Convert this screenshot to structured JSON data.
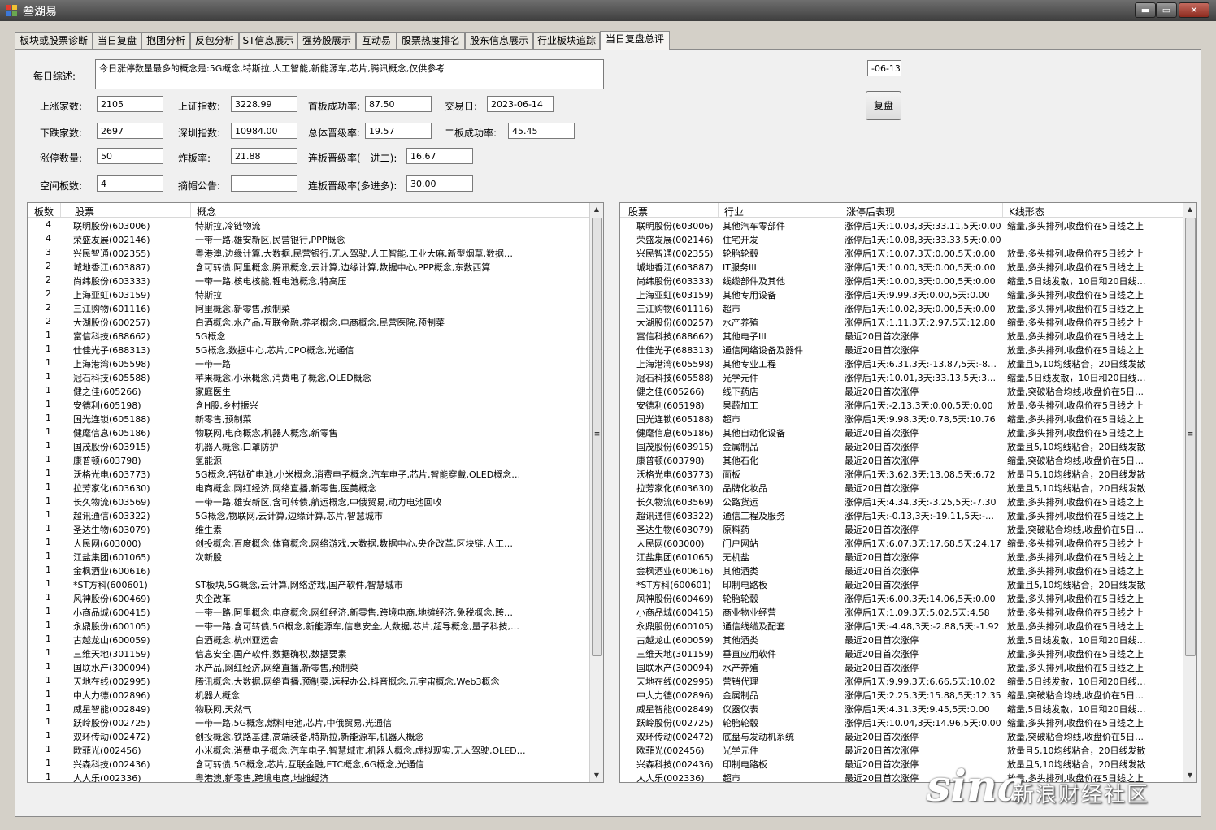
{
  "app": {
    "title": "叁湖易"
  },
  "window_buttons": {
    "minimize": "▬",
    "maximize": "▭",
    "close": "✕"
  },
  "tabs": [
    {
      "label": "板块或股票诊断"
    },
    {
      "label": "当日复盘"
    },
    {
      "label": "抱团分析"
    },
    {
      "label": "反包分析"
    },
    {
      "label": "ST信息展示"
    },
    {
      "label": "强势股展示"
    },
    {
      "label": "互动易"
    },
    {
      "label": "股票热度排名"
    },
    {
      "label": "股东信息展示"
    },
    {
      "label": "行业板块追踪"
    },
    {
      "label": "当日复盘总评"
    }
  ],
  "active_tab_index": 10,
  "summary": {
    "label": "每日综述:",
    "value": "今日涨停数量最多的概念是:5G概念,特斯拉,人工智能,新能源车,芯片,腾讯概念,仅供参考"
  },
  "stats": {
    "up_count": {
      "label": "上涨家数:",
      "value": "2105"
    },
    "sh_index": {
      "label": "上证指数:",
      "value": "3228.99"
    },
    "first_board_rate": {
      "label": "首板成功率:",
      "value": "87.50"
    },
    "trade_day": {
      "label": "交易日:",
      "value": "2023-06-14"
    },
    "down_count": {
      "label": "下跌家数:",
      "value": "2697"
    },
    "sz_index": {
      "label": "深圳指数:",
      "value": "10984.00"
    },
    "total_promo_rate": {
      "label": "总体晋级率:",
      "value": "19.57"
    },
    "second_board_rate": {
      "label": "二板成功率:",
      "value": "45.45"
    },
    "limit_up_count": {
      "label": "涨停数量:",
      "value": "50"
    },
    "broken_rate": {
      "label": "炸板率:",
      "value": "21.88"
    },
    "promo_1to2": {
      "label": "连板晋级率(一进二):",
      "value": "16.67"
    },
    "space_board": {
      "label": "空间板数:",
      "value": "4"
    },
    "delisting_notice": {
      "label": "摘帽公告:",
      "value": ""
    },
    "promo_multi": {
      "label": "连板晋级率(多进多):",
      "value": "30.00"
    }
  },
  "date_field": {
    "value": "-06-13"
  },
  "review_button": {
    "label": "复盘"
  },
  "left_table": {
    "columns": [
      "板数",
      "股票",
      "概念"
    ],
    "rows": [
      [
        "4",
        "联明股份(603006)",
        "特斯拉,冷链物流"
      ],
      [
        "4",
        "荣盛发展(002146)",
        "一带一路,雄安新区,民营银行,PPP概念"
      ],
      [
        "3",
        "兴民智通(002355)",
        "粤港澳,边缘计算,大数据,民营银行,无人驾驶,人工智能,工业大麻,新型烟草,数据…"
      ],
      [
        "2",
        "城地香江(603887)",
        "含可转债,阿里概念,腾讯概念,云计算,边缘计算,数据中心,PPP概念,东数西算"
      ],
      [
        "2",
        "尚纬股份(603333)",
        "一带一路,核电核能,锂电池概念,特高压"
      ],
      [
        "2",
        "上海亚虹(603159)",
        "特斯拉"
      ],
      [
        "2",
        "三江购物(601116)",
        "阿里概念,新零售,预制菜"
      ],
      [
        "2",
        "大湖股份(600257)",
        "白酒概念,水产品,互联金融,养老概念,电商概念,民营医院,预制菜"
      ],
      [
        "1",
        "富信科技(688662)",
        "5G概念"
      ],
      [
        "1",
        "仕佳光子(688313)",
        "5G概念,数据中心,芯片,CPO概念,光通信"
      ],
      [
        "1",
        "上海港湾(605598)",
        "一带一路"
      ],
      [
        "1",
        "冠石科技(605588)",
        "苹果概念,小米概念,消费电子概念,OLED概念"
      ],
      [
        "1",
        "健之佳(605266)",
        "家庭医生"
      ],
      [
        "1",
        "安德利(605198)",
        "含H股,乡村振兴"
      ],
      [
        "1",
        "国光连锁(605188)",
        "新零售,预制菜"
      ],
      [
        "1",
        "健麾信息(605186)",
        "物联网,电商概念,机器人概念,新零售"
      ],
      [
        "1",
        "国茂股份(603915)",
        "机器人概念,口罩防护"
      ],
      [
        "1",
        "康普顿(603798)",
        "氢能源"
      ],
      [
        "1",
        "沃格光电(603773)",
        "5G概念,钙钛矿电池,小米概念,消费电子概念,汽车电子,芯片,智能穿戴,OLED概念…"
      ],
      [
        "1",
        "拉芳家化(603630)",
        "电商概念,网红经济,网络直播,新零售,医美概念"
      ],
      [
        "1",
        "长久物流(603569)",
        "一带一路,雄安新区,含可转债,航运概念,中俄贸易,动力电池回收"
      ],
      [
        "1",
        "超讯通信(603322)",
        "5G概念,物联网,云计算,边缘计算,芯片,智慧城市"
      ],
      [
        "1",
        "圣达生物(603079)",
        "维生素"
      ],
      [
        "1",
        "人民网(603000)",
        "创投概念,百度概念,体育概念,网络游戏,大数据,数据中心,央企改革,区块链,人工…"
      ],
      [
        "1",
        "江盐集团(601065)",
        "次新股"
      ],
      [
        "1",
        "金枫酒业(600616)",
        ""
      ],
      [
        "1",
        "*ST方科(600601)",
        "ST板块,5G概念,云计算,网络游戏,国产软件,智慧城市"
      ],
      [
        "1",
        "风神股份(600469)",
        "央企改革"
      ],
      [
        "1",
        "小商品城(600415)",
        "一带一路,阿里概念,电商概念,网红经济,新零售,跨境电商,地摊经济,免税概念,跨…"
      ],
      [
        "1",
        "永鼎股份(600105)",
        "一带一路,含可转债,5G概念,新能源车,信息安全,大数据,芯片,超导概念,量子科技,…"
      ],
      [
        "1",
        "古越龙山(600059)",
        "白酒概念,杭州亚运会"
      ],
      [
        "1",
        "三维天地(301159)",
        "信息安全,国产软件,数据确权,数据要素"
      ],
      [
        "1",
        "国联水产(300094)",
        "水产品,网红经济,网络直播,新零售,预制菜"
      ],
      [
        "1",
        "天地在线(002995)",
        "腾讯概念,大数据,网络直播,预制菜,远程办公,抖音概念,元宇宙概念,Web3概念"
      ],
      [
        "1",
        "中大力德(002896)",
        "机器人概念"
      ],
      [
        "1",
        "威星智能(002849)",
        "物联网,天然气"
      ],
      [
        "1",
        "跃岭股份(002725)",
        "一带一路,5G概念,燃料电池,芯片,中俄贸易,光通信"
      ],
      [
        "1",
        "双环传动(002472)",
        "创投概念,铁路基建,高端装备,特斯拉,新能源车,机器人概念"
      ],
      [
        "1",
        "欧菲光(002456)",
        "小米概念,消费电子概念,汽车电子,智慧城市,机器人概念,虚拟现实,无人驾驶,OLED…"
      ],
      [
        "1",
        "兴森科技(002436)",
        "含可转债,5G概念,芯片,互联金融,ETC概念,6G概念,光通信"
      ],
      [
        "1",
        "人人乐(002336)",
        "粤港澳,新零售,跨境电商,地摊经济"
      ]
    ]
  },
  "right_table": {
    "columns": [
      "股票",
      "行业",
      "涨停后表现",
      "K线形态"
    ],
    "rows": [
      [
        "联明股份(603006)",
        "其他汽车零部件",
        "涨停后1天:10.03,3天:33.11,5天:0.00",
        "缩量,多头排列,收盘价在5日线之上"
      ],
      [
        "荣盛发展(002146)",
        "住宅开发",
        "涨停后1天:10.08,3天:33.33,5天:0.00",
        ""
      ],
      [
        "兴民智通(002355)",
        "轮胎轮毂",
        "涨停后1天:10.07,3天:0.00,5天:0.00",
        "放量,多头排列,收盘价在5日线之上"
      ],
      [
        "城地香江(603887)",
        "IT服务III",
        "涨停后1天:10.00,3天:0.00,5天:0.00",
        "放量,多头排列,收盘价在5日线之上"
      ],
      [
        "尚纬股份(603333)",
        "线缆部件及其他",
        "涨停后1天:10.00,3天:0.00,5天:0.00",
        "缩量,5日线发散，10日和20日线…"
      ],
      [
        "上海亚虹(603159)",
        "其他专用设备",
        "涨停后1天:9.99,3天:0.00,5天:0.00",
        "缩量,多头排列,收盘价在5日线之上"
      ],
      [
        "三江购物(601116)",
        "超市",
        "涨停后1天:10.02,3天:0.00,5天:0.00",
        "放量,多头排列,收盘价在5日线之上"
      ],
      [
        "大湖股份(600257)",
        "水产养殖",
        "涨停后1天:1.11,3天:2.97,5天:12.80",
        "缩量,多头排列,收盘价在5日线之上"
      ],
      [
        "富信科技(688662)",
        "其他电子III",
        "最近20日首次涨停",
        "放量,多头排列,收盘价在5日线之上"
      ],
      [
        "仕佳光子(688313)",
        "通信网络设备及器件",
        "最近20日首次涨停",
        "放量,多头排列,收盘价在5日线之上"
      ],
      [
        "上海港湾(605598)",
        "其他专业工程",
        "涨停后1天:6.31,3天:-13.87,5天:-8…",
        "放量且5,10均线粘合，20日线发散"
      ],
      [
        "冠石科技(605588)",
        "光学元件",
        "涨停后1天:10.01,3天:33.13,5天:3…",
        "缩量,5日线发散，10日和20日线…"
      ],
      [
        "健之佳(605266)",
        "线下药店",
        "最近20日首次涨停",
        "放量,突破粘合均线,收盘价在5日…"
      ],
      [
        "安德利(605198)",
        "果蔬加工",
        "涨停后1天:-2.13,3天:0.00,5天:0.00",
        "放量,多头排列,收盘价在5日线之上"
      ],
      [
        "国光连锁(605188)",
        "超市",
        "涨停后1天:9.98,3天:0.78,5天:10.76",
        "缩量,多头排列,收盘价在5日线之上"
      ],
      [
        "健麾信息(605186)",
        "其他自动化设备",
        "最近20日首次涨停",
        "放量,多头排列,收盘价在5日线之上"
      ],
      [
        "国茂股份(603915)",
        "金属制品",
        "最近20日首次涨停",
        "放量且5,10均线粘合，20日线发散"
      ],
      [
        "康普顿(603798)",
        "其他石化",
        "最近20日首次涨停",
        "缩量,突破粘合均线,收盘价在5日…"
      ],
      [
        "沃格光电(603773)",
        "面板",
        "涨停后1天:3.62,3天:13.08,5天:6.72",
        "放量且5,10均线粘合，20日线发散"
      ],
      [
        "拉芳家化(603630)",
        "品牌化妆品",
        "最近20日首次涨停",
        "放量且5,10均线粘合，20日线发散"
      ],
      [
        "长久物流(603569)",
        "公路货运",
        "涨停后1天:4.34,3天:-3.25,5天:-7.30",
        "放量,多头排列,收盘价在5日线之上"
      ],
      [
        "超讯通信(603322)",
        "通信工程及服务",
        "涨停后1天:-0.13,3天:-19.11,5天:-…",
        "放量,多头排列,收盘价在5日线之上"
      ],
      [
        "圣达生物(603079)",
        "原料药",
        "最近20日首次涨停",
        "放量,突破粘合均线,收盘价在5日…"
      ],
      [
        "人民网(603000)",
        "门户网站",
        "涨停后1天:6.07,3天:17.68,5天:24.17",
        "缩量,多头排列,收盘价在5日线之上"
      ],
      [
        "江盐集团(601065)",
        "无机盐",
        "最近20日首次涨停",
        "放量,多头排列,收盘价在5日线之上"
      ],
      [
        "金枫酒业(600616)",
        "其他酒类",
        "最近20日首次涨停",
        "放量,多头排列,收盘价在5日线之上"
      ],
      [
        "*ST方科(600601)",
        "印制电路板",
        "最近20日首次涨停",
        "放量且5,10均线粘合，20日线发散"
      ],
      [
        "风神股份(600469)",
        "轮胎轮毂",
        "涨停后1天:6.00,3天:14.06,5天:0.00",
        "放量,多头排列,收盘价在5日线之上"
      ],
      [
        "小商品城(600415)",
        "商业物业经营",
        "涨停后1天:1.09,3天:5.02,5天:4.58",
        "放量,多头排列,收盘价在5日线之上"
      ],
      [
        "永鼎股份(600105)",
        "通信线缆及配套",
        "涨停后1天:-4.48,3天:-2.88,5天:-1.92",
        "放量,多头排列,收盘价在5日线之上"
      ],
      [
        "古越龙山(600059)",
        "其他酒类",
        "最近20日首次涨停",
        "放量,5日线发散，10日和20日线…"
      ],
      [
        "三维天地(301159)",
        "垂直应用软件",
        "最近20日首次涨停",
        "放量,多头排列,收盘价在5日线之上"
      ],
      [
        "国联水产(300094)",
        "水产养殖",
        "最近20日首次涨停",
        "放量,多头排列,收盘价在5日线之上"
      ],
      [
        "天地在线(002995)",
        "营销代理",
        "涨停后1天:9.99,3天:6.66,5天:10.02",
        "缩量,5日线发散，10日和20日线…"
      ],
      [
        "中大力德(002896)",
        "金属制品",
        "涨停后1天:2.25,3天:15.88,5天:12.35",
        "缩量,突破粘合均线,收盘价在5日…"
      ],
      [
        "威星智能(002849)",
        "仪器仪表",
        "涨停后1天:4.31,3天:9.45,5天:0.00",
        "缩量,5日线发散，10日和20日线…"
      ],
      [
        "跃岭股份(002725)",
        "轮胎轮毂",
        "涨停后1天:10.04,3天:14.96,5天:0.00",
        "缩量,多头排列,收盘价在5日线之上"
      ],
      [
        "双环传动(002472)",
        "底盘与发动机系统",
        "最近20日首次涨停",
        "放量,突破粘合均线,收盘价在5日…"
      ],
      [
        "欧菲光(002456)",
        "光学元件",
        "最近20日首次涨停",
        "放量且5,10均线粘合，20日线发散"
      ],
      [
        "兴森科技(002436)",
        "印制电路板",
        "最近20日首次涨停",
        "放量且5,10均线粘合，20日线发散"
      ],
      [
        "人人乐(002336)",
        "超市",
        "最近20日首次涨停",
        "放量,多头排列,收盘价在5日线之上"
      ]
    ]
  },
  "scroll_arrows": {
    "up": "▲",
    "down": "▼",
    "grip": "≡"
  },
  "watermark": {
    "logo": "sina",
    "text": "新浪财经社区"
  }
}
